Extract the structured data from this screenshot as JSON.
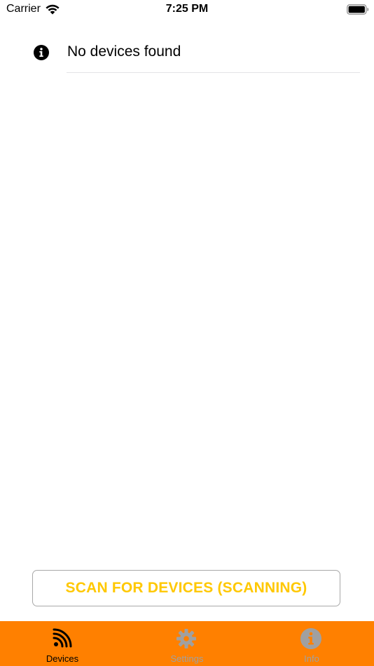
{
  "status_bar": {
    "carrier": "Carrier",
    "time": "7:25 PM",
    "wifi_icon": "wifi-icon",
    "battery_icon": "battery-icon"
  },
  "device_list": {
    "empty_icon": "info-icon",
    "empty_message": "No devices found"
  },
  "scan_button": {
    "label": "SCAN FOR DEVICES (SCANNING)",
    "color": "#ffc800"
  },
  "tab_bar": {
    "background": "#ff8000",
    "active_color": "#000000",
    "inactive_color": "#a0a0a0",
    "tabs": [
      {
        "label": "Devices",
        "icon": "rss-icon",
        "active": true
      },
      {
        "label": "Settings",
        "icon": "gear-icon",
        "active": false
      },
      {
        "label": "Info",
        "icon": "info-circle-icon",
        "active": false
      }
    ]
  }
}
